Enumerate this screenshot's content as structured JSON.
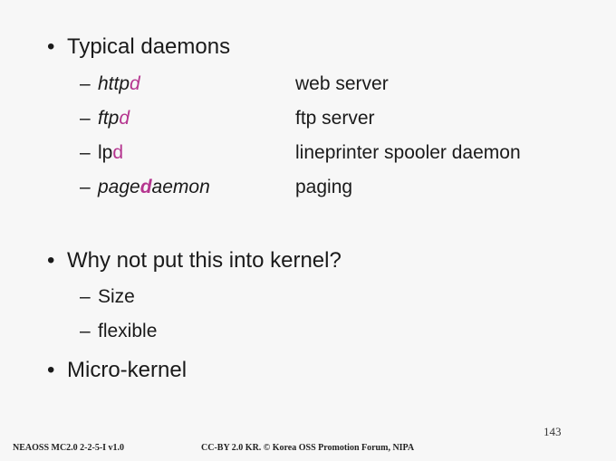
{
  "bullets": {
    "typical": "Typical daemons",
    "why": "Why not put this into kernel?",
    "micro": "Micro-kernel"
  },
  "bullet_symbol": "•",
  "dash_symbol": "–",
  "daemons": [
    {
      "term_plain": "http",
      "term_hl": "d",
      "desc": "web server"
    },
    {
      "term_plain": "ftp",
      "term_hl": "d",
      "desc": "ftp server"
    },
    {
      "term_plain": "lp",
      "term_hl": "d",
      "desc": "lineprinter spooler daemon"
    },
    {
      "term_pre": "page",
      "term_hl": "d",
      "term_post": "aemon",
      "desc": "paging"
    }
  ],
  "why_subs": [
    "Size",
    "flexible"
  ],
  "footer": {
    "left": "NEAOSS MC2.0 2-2-5-I v1.0",
    "center": "CC-BY 2.0 KR. © Korea OSS Promotion Forum, NIPA",
    "page_number": "143"
  },
  "colors": {
    "highlight": "#b5358f",
    "background": "#f7f7f7"
  }
}
